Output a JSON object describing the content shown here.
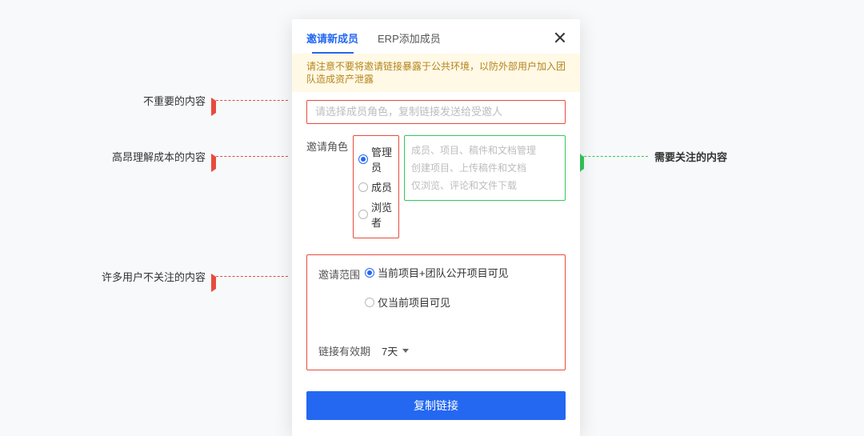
{
  "tabs": {
    "invite": "邀请新成员",
    "erp": "ERP添加成员"
  },
  "banner": "请注意不要将邀请链接暴露于公共环境，以防外部用户加入团队造成资产泄露",
  "input_placeholder": "请选择成员角色，复制链接发送给受邀人",
  "role": {
    "label": "邀请角色",
    "options": {
      "admin": {
        "label": "管理员",
        "desc": "成员、项目、稿件和文档管理"
      },
      "member": {
        "label": "成员",
        "desc": "创建项目、上传稿件和文档"
      },
      "viewer": {
        "label": "浏览者",
        "desc": "仅浏览、评论和文件下载"
      }
    }
  },
  "scope": {
    "label": "邀请范围",
    "opt1": "当前项目+团队公开项目可见",
    "opt2": "仅当前项目可见"
  },
  "expiry": {
    "label": "链接有效期",
    "value": "7天"
  },
  "primary_button": "复制链接",
  "annotations": {
    "a1": "不重要的内容",
    "a2": "高昂理解成本的内容",
    "a3": "许多用户不关注的内容",
    "a4": "需要关注的内容"
  }
}
